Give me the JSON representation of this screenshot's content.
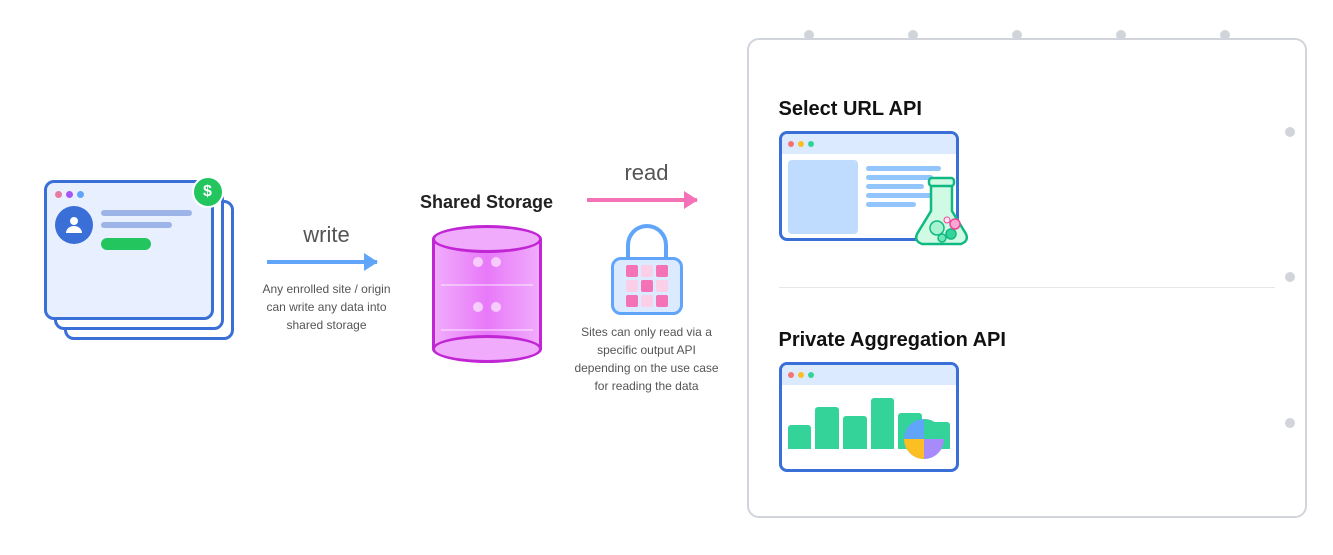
{
  "diagram": {
    "write_label": "write",
    "read_label": "read",
    "storage_title": "Shared Storage",
    "write_caption": "Any enrolled site / origin can write any data into shared storage",
    "read_caption": "Sites can only read via a specific output API depending on the use case for reading the data",
    "api1_title": "Select URL API",
    "api2_title": "Private Aggregation API"
  },
  "colors": {
    "blue": "#3a6fd8",
    "light_blue": "#60a5fa",
    "purple_pink": "#c026d3",
    "pink": "#f472b6",
    "green": "#22c55e"
  }
}
